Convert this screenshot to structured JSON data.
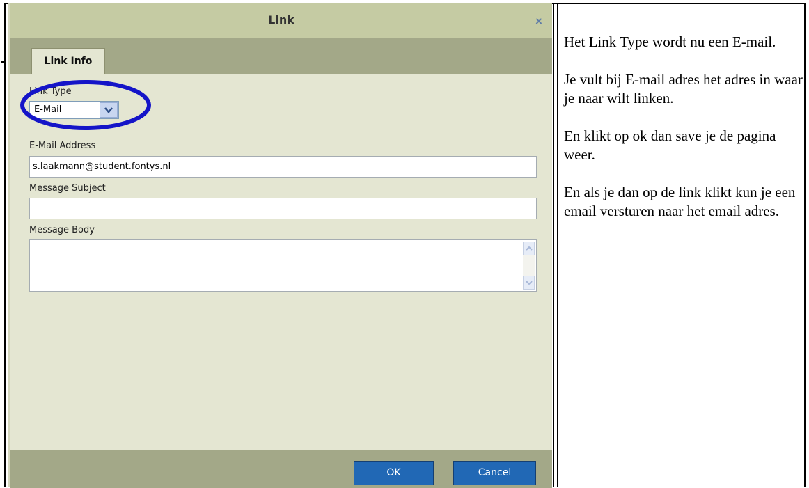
{
  "dialog": {
    "title": "Link",
    "close_label": "×",
    "tab_label": "Link Info",
    "link_type": {
      "label": "Link Type",
      "value": "E-Mail"
    },
    "email": {
      "label": "E-Mail Address",
      "value": "s.laakmann@student.fontys.nl"
    },
    "subject": {
      "label": "Message Subject",
      "value": ""
    },
    "body": {
      "label": "Message Body",
      "value": ""
    },
    "buttons": {
      "ok": "OK",
      "cancel": "Cancel"
    },
    "colors": {
      "highlight": "#1414c8",
      "button": "#2168b5",
      "titlebar": "#c5cba3"
    }
  },
  "notes": [
    "Het Link Type wordt nu een E-mail.",
    "Je vult bij E-mail adres het adres in waar je naar wilt linken.",
    "En klikt op ok dan save je de pagina weer.",
    "En als je dan op de link klikt kun je een email versturen naar het email adres."
  ]
}
